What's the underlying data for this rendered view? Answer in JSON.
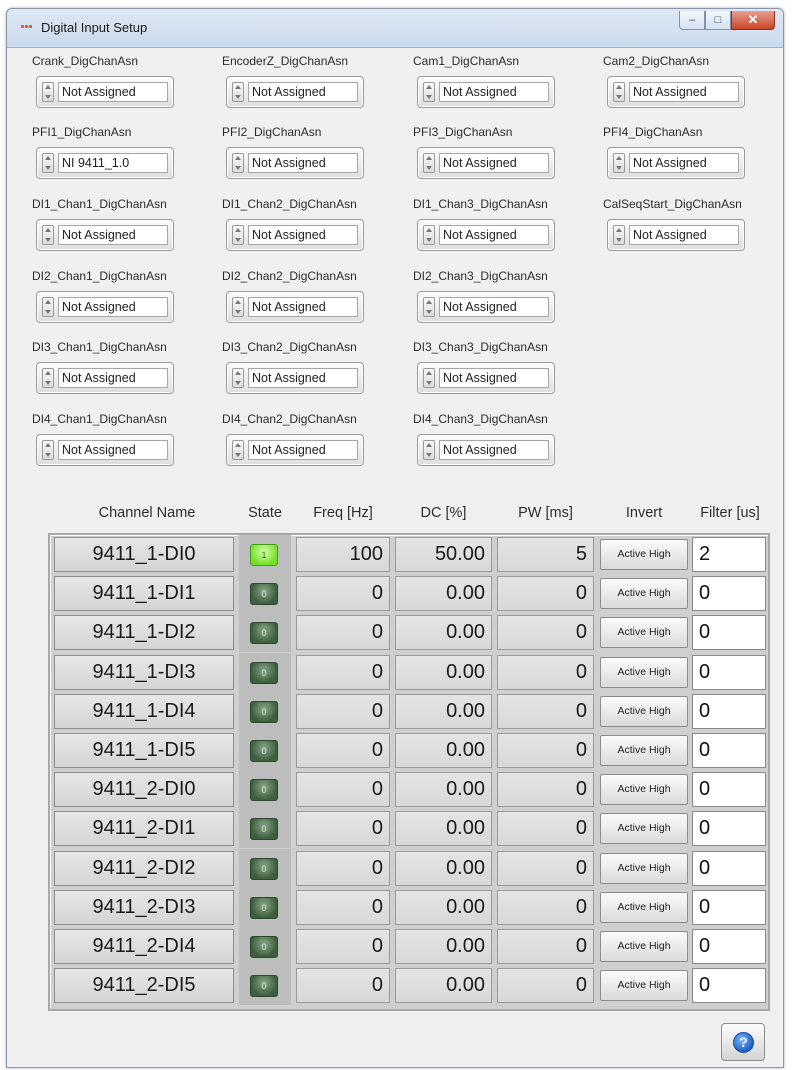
{
  "window": {
    "title": "Digital Input Setup",
    "controls": {
      "minimize": "–",
      "maximize": "□",
      "close": "✕"
    }
  },
  "assignments": [
    {
      "label": "Crank_DigChanAsn",
      "value": "Not Assigned"
    },
    {
      "label": "EncoderZ_DigChanAsn",
      "value": "Not Assigned"
    },
    {
      "label": "Cam1_DigChanAsn",
      "value": "Not Assigned"
    },
    {
      "label": "Cam2_DigChanAsn",
      "value": "Not Assigned"
    },
    {
      "label": "PFI1_DigChanAsn",
      "value": "NI 9411_1.0"
    },
    {
      "label": "PFI2_DigChanAsn",
      "value": "Not Assigned"
    },
    {
      "label": "PFI3_DigChanAsn",
      "value": "Not Assigned"
    },
    {
      "label": "PFI4_DigChanAsn",
      "value": "Not Assigned"
    },
    {
      "label": "DI1_Chan1_DigChanAsn",
      "value": "Not Assigned"
    },
    {
      "label": "DI1_Chan2_DigChanAsn",
      "value": "Not Assigned"
    },
    {
      "label": "DI1_Chan3_DigChanAsn",
      "value": "Not Assigned"
    },
    {
      "label": "CalSeqStart_DigChanAsn",
      "value": "Not Assigned"
    },
    {
      "label": "DI2_Chan1_DigChanAsn",
      "value": "Not Assigned"
    },
    {
      "label": "DI2_Chan2_DigChanAsn",
      "value": "Not Assigned"
    },
    {
      "label": "DI2_Chan3_DigChanAsn",
      "value": "Not Assigned"
    },
    {
      "label": "DI3_Chan1_DigChanAsn",
      "value": "Not Assigned"
    },
    {
      "label": "DI3_Chan2_DigChanAsn",
      "value": "Not Assigned"
    },
    {
      "label": "DI3_Chan3_DigChanAsn",
      "value": "Not Assigned"
    },
    {
      "label": "DI4_Chan1_DigChanAsn",
      "value": "Not Assigned"
    },
    {
      "label": "DI4_Chan2_DigChanAsn",
      "value": "Not Assigned"
    },
    {
      "label": "DI4_Chan3_DigChanAsn",
      "value": "Not Assigned"
    }
  ],
  "table": {
    "headers": {
      "channel_name": "Channel Name",
      "state": "State",
      "freq": "Freq [Hz]",
      "dc": "DC [%]",
      "pw": "PW [ms]",
      "invert": "Invert",
      "filter": "Filter [us]"
    },
    "rows": [
      {
        "name": "9411_1-DI0",
        "state": "1",
        "freq": "100",
        "dc": "50.00",
        "pw": "5",
        "invert": "Active High",
        "filter": "2"
      },
      {
        "name": "9411_1-DI1",
        "state": "0",
        "freq": "0",
        "dc": "0.00",
        "pw": "0",
        "invert": "Active High",
        "filter": "0"
      },
      {
        "name": "9411_1-DI2",
        "state": "0",
        "freq": "0",
        "dc": "0.00",
        "pw": "0",
        "invert": "Active High",
        "filter": "0"
      },
      {
        "name": "9411_1-DI3",
        "state": "0",
        "freq": "0",
        "dc": "0.00",
        "pw": "0",
        "invert": "Active High",
        "filter": "0"
      },
      {
        "name": "9411_1-DI4",
        "state": "0",
        "freq": "0",
        "dc": "0.00",
        "pw": "0",
        "invert": "Active High",
        "filter": "0"
      },
      {
        "name": "9411_1-DI5",
        "state": "0",
        "freq": "0",
        "dc": "0.00",
        "pw": "0",
        "invert": "Active High",
        "filter": "0"
      },
      {
        "name": "9411_2-DI0",
        "state": "0",
        "freq": "0",
        "dc": "0.00",
        "pw": "0",
        "invert": "Active High",
        "filter": "0"
      },
      {
        "name": "9411_2-DI1",
        "state": "0",
        "freq": "0",
        "dc": "0.00",
        "pw": "0",
        "invert": "Active High",
        "filter": "0"
      },
      {
        "name": "9411_2-DI2",
        "state": "0",
        "freq": "0",
        "dc": "0.00",
        "pw": "0",
        "invert": "Active High",
        "filter": "0"
      },
      {
        "name": "9411_2-DI3",
        "state": "0",
        "freq": "0",
        "dc": "0.00",
        "pw": "0",
        "invert": "Active High",
        "filter": "0"
      },
      {
        "name": "9411_2-DI4",
        "state": "0",
        "freq": "0",
        "dc": "0.00",
        "pw": "0",
        "invert": "Active High",
        "filter": "0"
      },
      {
        "name": "9411_2-DI5",
        "state": "0",
        "freq": "0",
        "dc": "0.00",
        "pw": "0",
        "invert": "Active High",
        "filter": "0"
      }
    ]
  },
  "help_button": {
    "icon": "help-icon",
    "glyph": "?"
  },
  "colors": {
    "led_on": "#6fe022",
    "led_off": "#3c5e3c",
    "close_button": "#c7452c"
  }
}
